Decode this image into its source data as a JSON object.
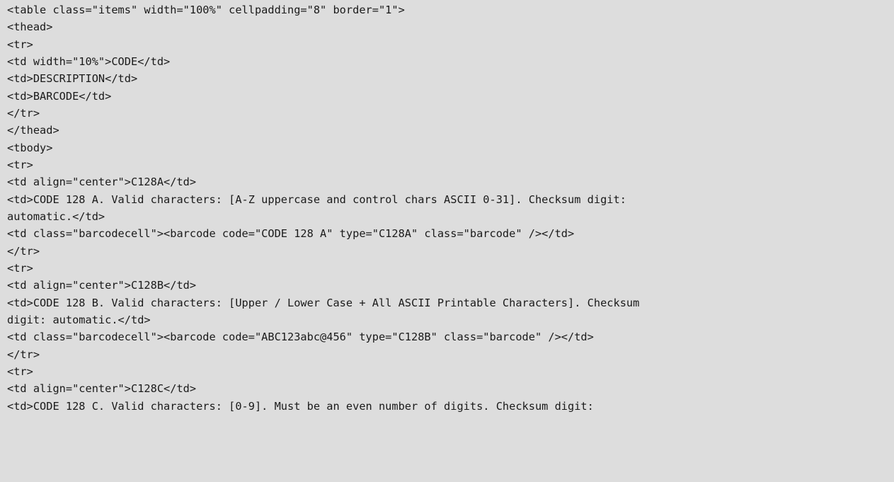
{
  "code_lines": [
    "<table class=\"items\" width=\"100%\" cellpadding=\"8\" border=\"1\">",
    "<thead>",
    "<tr>",
    "<td width=\"10%\">CODE</td>",
    "<td>DESCRIPTION</td>",
    "<td>BARCODE</td>",
    "</tr>",
    "</thead>",
    "<tbody>",
    "<tr>",
    "<td align=\"center\">C128A</td>",
    "<td>CODE 128 A. Valid characters: [A-Z uppercase and control chars ASCII 0-31]. Checksum digit:",
    "automatic.</td>",
    "<td class=\"barcodecell\"><barcode code=\"CODE 128 A\" type=\"C128A\" class=\"barcode\" /></td>",
    "</tr>",
    "<tr>",
    "<td align=\"center\">C128B</td>",
    "<td>CODE 128 B. Valid characters: [Upper / Lower Case + All ASCII Printable Characters]. Checksum",
    "digit: automatic.</td>",
    "<td class=\"barcodecell\"><barcode code=\"ABC123abc@456\" type=\"C128B\" class=\"barcode\" /></td>",
    "</tr>",
    "<tr>",
    "<td align=\"center\">C128C</td>",
    "<td>CODE 128 C. Valid characters: [0-9]. Must be an even number of digits. Checksum digit:"
  ]
}
